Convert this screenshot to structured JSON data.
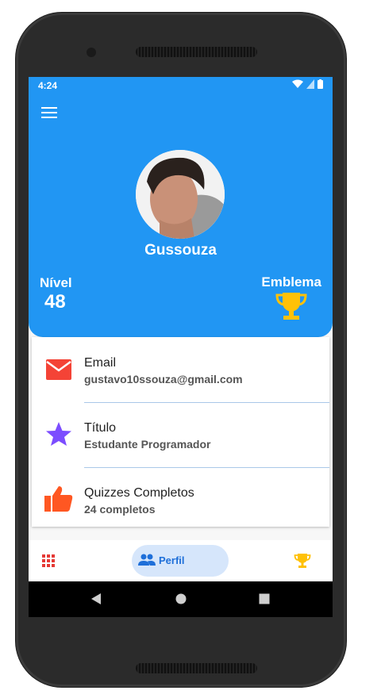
{
  "status": {
    "time": "4:24"
  },
  "profile": {
    "username": "Gussouza"
  },
  "stats": {
    "nivel_label": "Nível",
    "nivel_value": "48",
    "emblema_label": "Emblema"
  },
  "info": {
    "email_title": "Email",
    "email_value": "gustavo10ssouza@gmail.com",
    "titulo_title": "Título",
    "titulo_value": "Estudante Programador",
    "quizzes_title": "Quizzes Completos",
    "quizzes_value": "24 completos"
  },
  "nav": {
    "perfil_label": "Perfil"
  },
  "colors": {
    "primary": "#2196f3",
    "email_icon": "#f44336",
    "star_icon": "#7c4dff",
    "thumb_icon": "#ff5722",
    "trophy": "#ffc107",
    "nav_active_bg": "#d6e6fb"
  },
  "icons": [
    "menu-icon",
    "email-icon",
    "star-icon",
    "thumb-up-icon",
    "trophy-icon",
    "grid-icon",
    "people-icon",
    "back-icon",
    "home-icon",
    "recents-icon"
  ]
}
